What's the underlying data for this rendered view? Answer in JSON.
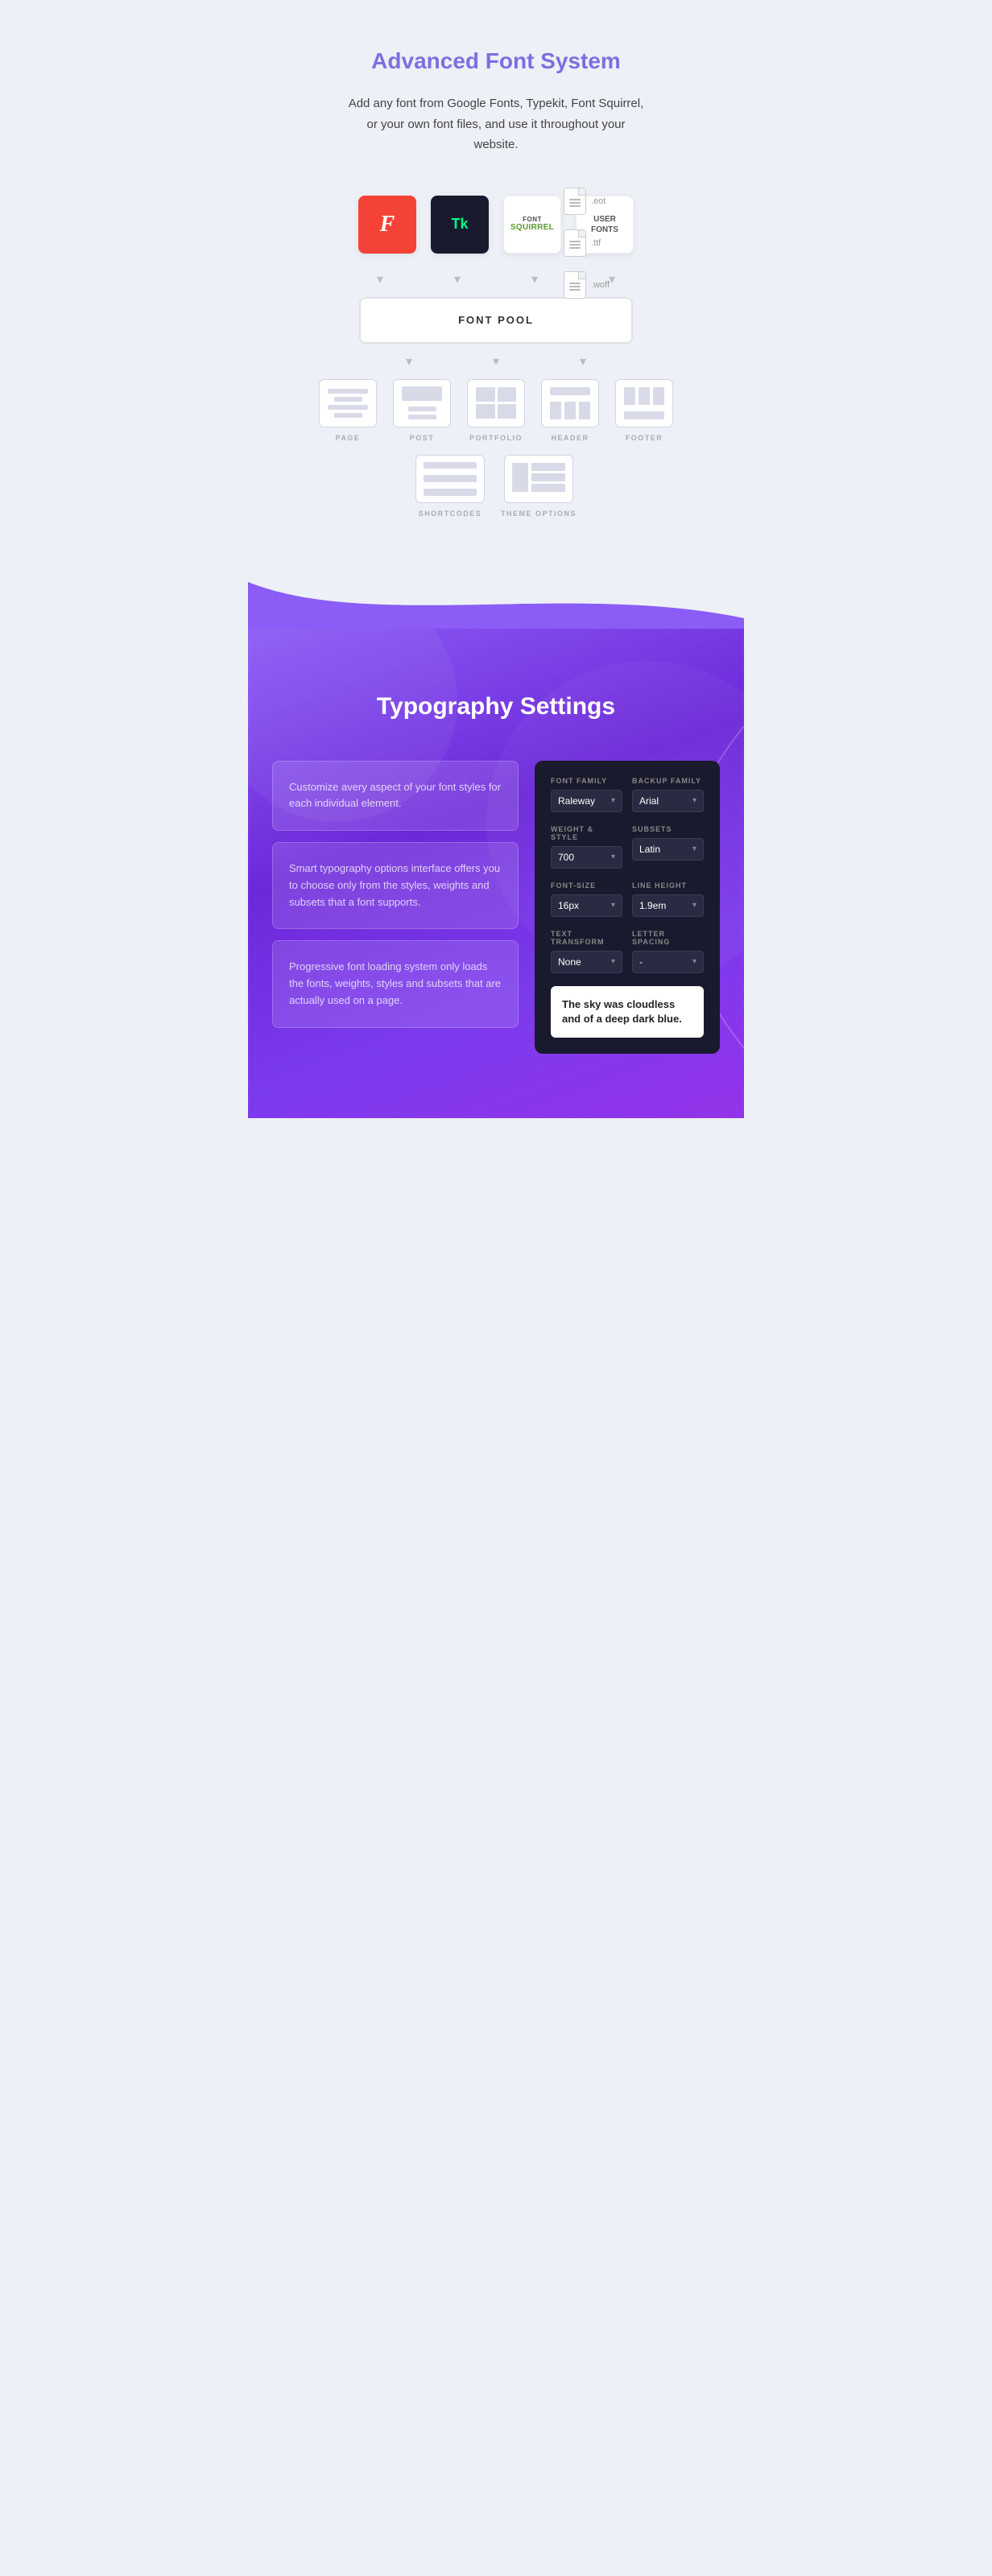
{
  "section1": {
    "title": "Advanced Font System",
    "subtitle": "Add any font from Google Fonts, Typekit, Font Squirrel, or your own font files, and use it throughout your website.",
    "fontSources": [
      {
        "id": "google",
        "label": "F",
        "type": "google"
      },
      {
        "id": "typekit",
        "label": "Tk",
        "type": "typekit"
      },
      {
        "id": "fontsquirrel",
        "label": "FONT SQUIRREL",
        "type": "fontsquirrel"
      },
      {
        "id": "userfonts",
        "label": "USER FONTS",
        "type": "userfont"
      }
    ],
    "fileTypes": [
      ".eot",
      ".ttf",
      ".woff"
    ],
    "fontPoolLabel": "FONT POOL",
    "usageItems": [
      {
        "id": "page",
        "label": "PAGE",
        "type": "page"
      },
      {
        "id": "post",
        "label": "POST",
        "type": "post"
      },
      {
        "id": "portfolio",
        "label": "PORTFOLIO",
        "type": "portfolio"
      },
      {
        "id": "header",
        "label": "HEADER",
        "type": "header"
      },
      {
        "id": "footer",
        "label": "FOOTER",
        "type": "footer"
      }
    ],
    "usageItems2": [
      {
        "id": "shortcodes",
        "label": "SHORTCODES",
        "type": "shortcodes"
      },
      {
        "id": "themeoptions",
        "label": "THEME OPTIONS",
        "type": "themeoptions"
      }
    ]
  },
  "section2": {
    "title": "Typography Settings",
    "cards": [
      {
        "text": "Customize avery aspect of your font styles for each individual element."
      },
      {
        "text": "Smart typography options interface offers you to choose only from the styles, weights and subsets that a font supports."
      },
      {
        "text": "Progressive font loading system only loads the fonts, weights, styles and subsets that are actually used on a page."
      }
    ],
    "panel": {
      "fields": [
        {
          "group": "row1",
          "fields": [
            {
              "label": "FONT FAMILY",
              "value": "Raleway",
              "name": "font-family-select"
            },
            {
              "label": "BACKUP FAMILY",
              "value": "Arial",
              "name": "backup-family-select"
            }
          ]
        },
        {
          "group": "row2",
          "fields": [
            {
              "label": "WEIGHT & STYLE",
              "value": "700",
              "name": "weight-style-select"
            },
            {
              "label": "SUBSETS",
              "value": "Latin",
              "name": "subsets-select"
            }
          ]
        },
        {
          "group": "row3",
          "fields": [
            {
              "label": "FONT-SIZE",
              "value": "16px",
              "name": "fontsize-select"
            },
            {
              "label": "LINE HEIGHT",
              "value": "1.9em",
              "name": "lineheight-select"
            }
          ]
        },
        {
          "group": "row4",
          "fields": [
            {
              "label": "TEXT TRANSFORM",
              "value": "None",
              "name": "texttransform-select"
            },
            {
              "label": "LETTER SPACING",
              "value": "-",
              "name": "letterspacing-select"
            }
          ]
        }
      ],
      "preview": "The sky was cloudless and of a deep dark blue."
    }
  }
}
